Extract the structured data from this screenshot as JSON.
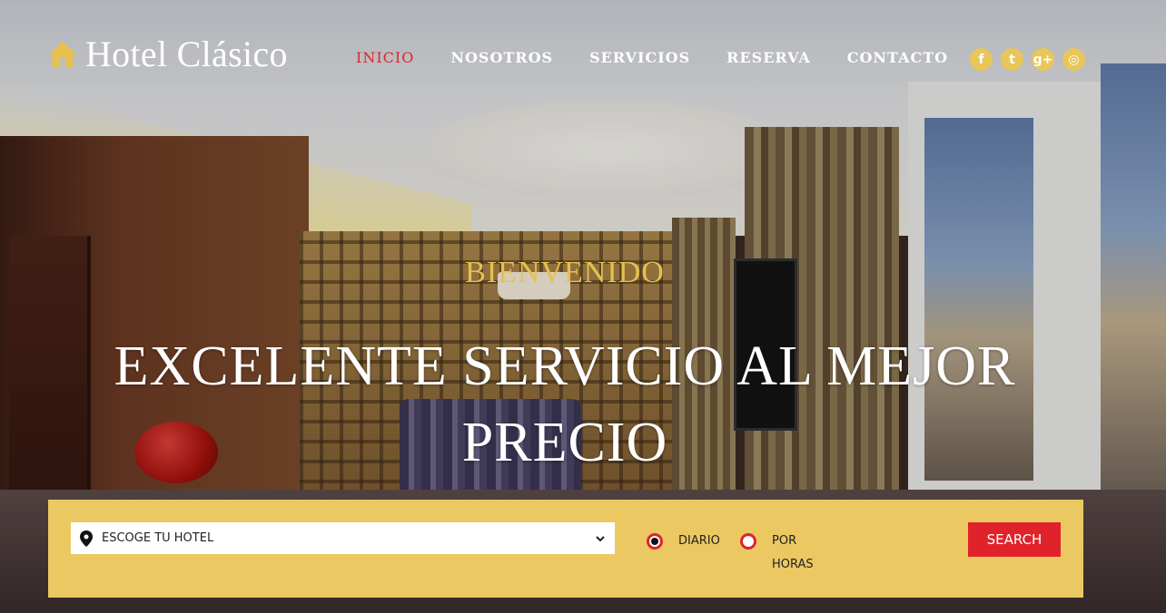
{
  "brand": {
    "name": "Hotel Clásico",
    "icon": "home-icon",
    "icon_color": "#e8c04f"
  },
  "nav": {
    "items": [
      {
        "label": "INICIO",
        "active": true
      },
      {
        "label": "NOSOTROS",
        "active": false
      },
      {
        "label": "SERVICIOS",
        "active": false
      },
      {
        "label": "RESERVA",
        "active": false
      },
      {
        "label": "CONTACTO",
        "active": false
      }
    ],
    "active_color": "#e4232b"
  },
  "social": [
    {
      "icon": "facebook-icon",
      "glyph": "f"
    },
    {
      "icon": "twitter-icon",
      "glyph": "t"
    },
    {
      "icon": "google-plus-icon",
      "glyph": "g+"
    },
    {
      "icon": "dribbble-icon",
      "glyph": "◎"
    }
  ],
  "hero": {
    "welcome": "BIENVENIDO",
    "headline": "EXCELENTE SERVICIO AL MEJOR PRECIO"
  },
  "booking": {
    "hotel_select": {
      "value": "ESCOGE TU HOTEL",
      "icon": "location-pin-icon"
    },
    "rate_options": [
      {
        "label": "DIARIO",
        "selected": true
      },
      {
        "label": "POR HORAS",
        "selected": false
      }
    ],
    "search_label": "SEARCH",
    "bar_color": "#ebc862",
    "accent_color": "#e0232a"
  }
}
